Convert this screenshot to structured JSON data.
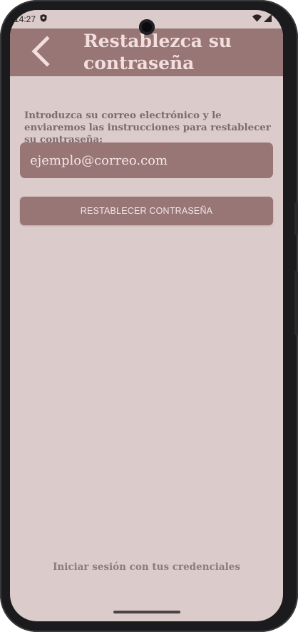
{
  "status_bar": {
    "time": "14:27",
    "left_icon": "shield-icon",
    "right_icons": [
      "wifi-icon",
      "signal-icon"
    ]
  },
  "app_bar": {
    "back_icon": "chevron-left-icon",
    "title": "Restablezca su contraseña"
  },
  "form": {
    "instructions": "Introduzca su correo electrónico y le enviaremos las instrucciones para restablecer su contraseña:",
    "email_placeholder": "ejemplo@correo.com",
    "email_value": "",
    "submit_label": "RESTABLECER CONTRASEÑA"
  },
  "footer": {
    "login_link": "Iniciar sesión con tus credenciales"
  },
  "colors": {
    "background": "#dbcbcb",
    "primary": "#997676",
    "title_text": "#f3dede",
    "body_text": "#7e6b6b"
  }
}
